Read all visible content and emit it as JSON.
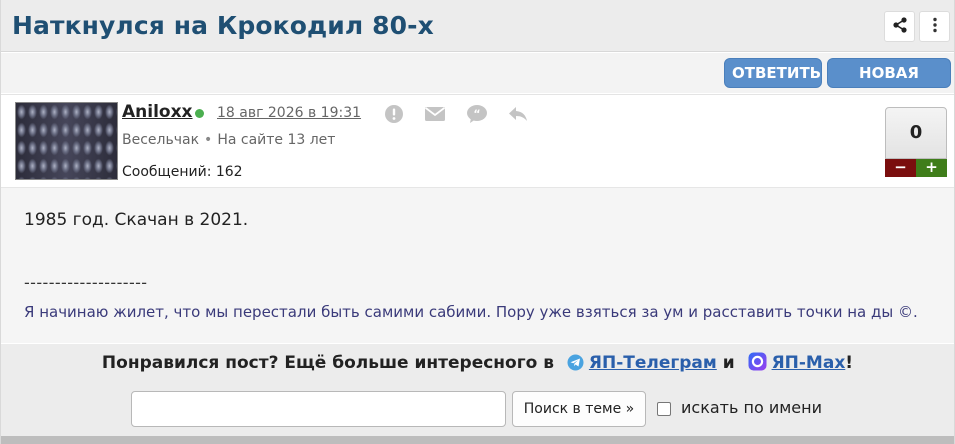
{
  "topic": {
    "title": "Наткнулся на Крокодил 80-х"
  },
  "header_icons": [
    "share-icon",
    "more-vertical-icon"
  ],
  "actions": {
    "reply_label": "ОТВЕТИТЬ",
    "new_topic_label": "НОВАЯ ТЕМА"
  },
  "post": {
    "author": "Aniloxx",
    "date": "18 авг 2026 в 19:31",
    "rank": "Весельчак",
    "separator": "•",
    "on_site": "На сайте 13 лет",
    "messages": "Сообщений: 162",
    "rating": "0",
    "rate_minus": "−",
    "rate_plus": "+",
    "text": "1985 год. Скачан в 2021.",
    "signature_rule": "--------------------",
    "signature": "Я начинаю жилет, что мы перестали быть самими сабими. Пору уже взяться за ум и расставить точки на ды ©.",
    "action_icons": [
      "report-icon",
      "mail-icon",
      "quote-icon",
      "reply-arrow-icon"
    ]
  },
  "promo": {
    "text_before": "Понравился пост? Ещё больше интересного в",
    "telegram_link": "ЯП-Телеграм",
    "and": "и",
    "max_link": "ЯП-Max",
    "tail": "!"
  },
  "search": {
    "input_value": "",
    "placeholder": "",
    "button_label": "Поиск в теме »",
    "checkbox_label": "искать по имени",
    "checkbox_checked": false
  },
  "colors": {
    "title": "#1f4f73",
    "button_blue": "#5a8fcb",
    "online": "#4caf50",
    "minus": "#7a0e0e",
    "plus": "#3f7d1a",
    "link": "#2a5fab"
  }
}
